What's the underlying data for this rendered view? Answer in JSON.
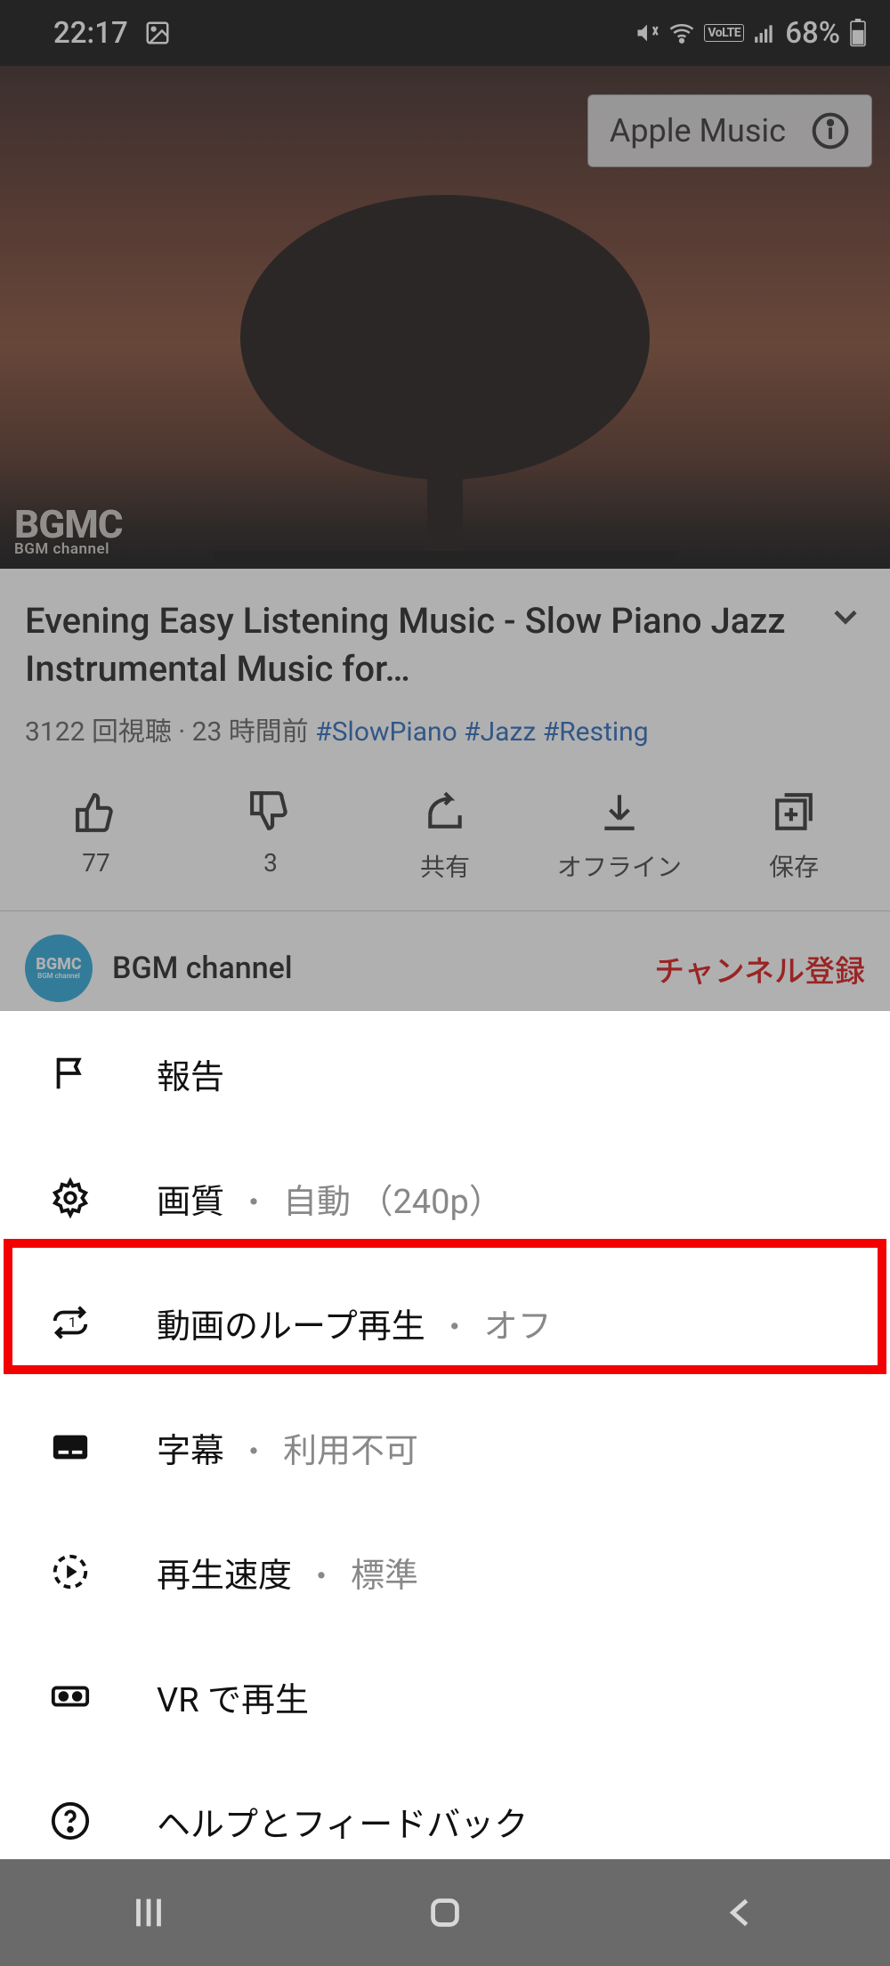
{
  "status": {
    "time": "22:17",
    "battery_pct": "68%"
  },
  "video": {
    "badge_label": "Apple Music",
    "watermark_main": "BGMC",
    "watermark_sub": "BGM channel"
  },
  "title": {
    "text": "Evening Easy Listening Music - Slow Piano Jazz Instrumental Music for…",
    "views": "3122 回視聴",
    "sep": " · ",
    "when": "23 時間前",
    "hashtags": [
      "#SlowPiano",
      "#Jazz",
      "#Resting"
    ]
  },
  "actions": {
    "like": "77",
    "dislike": "3",
    "share": "共有",
    "offline": "オフライン",
    "save": "保存"
  },
  "channel": {
    "name": "BGM channel",
    "avatar_text": "BGMC",
    "subscribe": "チャンネル登録"
  },
  "menu": {
    "report": "報告",
    "quality_label": "画質",
    "quality_value": "自動 （240p）",
    "loop_label": "動画のループ再生",
    "loop_value": "オフ",
    "captions_label": "字幕",
    "captions_value": "利用不可",
    "speed_label": "再生速度",
    "speed_value": "標準",
    "vr_label": "VR で再生",
    "help_label": "ヘルプとフィードバック",
    "dot": "・"
  }
}
